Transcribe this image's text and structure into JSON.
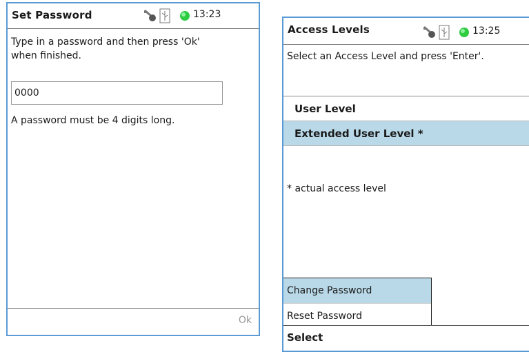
{
  "colors": {
    "frame_border": "#5b9bd5",
    "selection": "#b9d9e8",
    "status_led": "#2ecc40",
    "disabled_text": "#9a9a9a"
  },
  "status_icons": [
    "key-icon",
    "usb-icon",
    "green-led-icon"
  ],
  "set_password": {
    "title": "Set Password",
    "time": "13:23",
    "instruction": "Type in a password and then press 'Ok' when finished.",
    "password_value": "0000",
    "hint": "A password must be 4 digits long.",
    "ok_label": "Ok"
  },
  "access_levels": {
    "title": "Access Levels",
    "time": "13:25",
    "instruction": "Select an Access Level and press 'Enter'.",
    "items": [
      {
        "label": "User Level",
        "selected": false
      },
      {
        "label": "Extended User Level *",
        "selected": true
      }
    ],
    "note": "* actual access level",
    "menu": [
      {
        "label": "Change Password",
        "selected": true
      },
      {
        "label": "Reset Password",
        "selected": false
      }
    ],
    "softkey_label": "Select"
  }
}
